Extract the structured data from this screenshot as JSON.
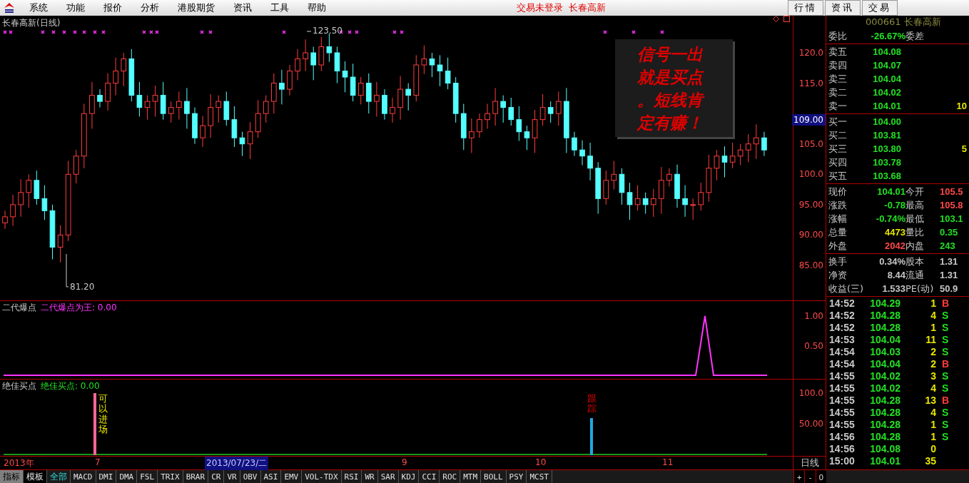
{
  "menu_bar": {
    "items": [
      "系统",
      "功能",
      "报价",
      "分析",
      "港股期货",
      "资讯",
      "工具",
      "帮助"
    ],
    "status": [
      "交易未登录",
      "长春高新"
    ],
    "buttons": [
      "行情",
      "资讯",
      "交易"
    ]
  },
  "chart": {
    "title": "长春高新(日线)",
    "high_label": "123.50",
    "low_label": "81.20",
    "annotation": "信号一出就是买点。短线肯定有赚！",
    "price_axis": [
      "120.0",
      "115.0",
      "105.0",
      "100.0",
      "95.00",
      "90.00",
      "85.00"
    ],
    "cursor_price": "109.00"
  },
  "indicator_1": {
    "name": "二代爆点",
    "value_label": "二代爆点为王: 0.00",
    "axis": [
      "1.00",
      "0.50"
    ]
  },
  "indicator_2": {
    "name": "绝佳买点",
    "value_label": "绝佳买点: 0.00",
    "signals": [
      "可以进场",
      "跟踪"
    ],
    "axis": [
      "100.0",
      "50.00"
    ]
  },
  "date_axis": {
    "labels": [
      "2013年",
      "7",
      "9",
      "10",
      "11"
    ],
    "cursor_date": "2013/07/23/二",
    "period": "日线",
    "zoom_buttons": [
      "+",
      "-",
      "0"
    ]
  },
  "bottom_bar": {
    "modes": [
      {
        "label": "指标",
        "selected": true
      },
      {
        "label": "模板",
        "selected": false
      }
    ],
    "indicators": [
      {
        "label": "全部",
        "selected": true
      },
      {
        "label": "MACD",
        "selected": false
      },
      {
        "label": "DMI",
        "selected": false
      },
      {
        "label": "DMA",
        "selected": false
      },
      {
        "label": "FSL",
        "selected": false
      },
      {
        "label": "TRIX",
        "selected": false
      },
      {
        "label": "BRAR",
        "selected": false
      },
      {
        "label": "CR",
        "selected": false
      },
      {
        "label": "VR",
        "selected": false
      },
      {
        "label": "OBV",
        "selected": false
      },
      {
        "label": "ASI",
        "selected": false
      },
      {
        "label": "EMV",
        "selected": false
      },
      {
        "label": "VOL-TDX",
        "selected": false
      },
      {
        "label": "RSI",
        "selected": false
      },
      {
        "label": "WR",
        "selected": false
      },
      {
        "label": "SAR",
        "selected": false
      },
      {
        "label": "KDJ",
        "selected": false
      },
      {
        "label": "CCI",
        "selected": false
      },
      {
        "label": "ROC",
        "selected": false
      },
      {
        "label": "MTM",
        "selected": false
      },
      {
        "label": "BOLL",
        "selected": false
      },
      {
        "label": "PSY",
        "selected": false
      },
      {
        "label": "MCST",
        "selected": false
      }
    ]
  },
  "quote": {
    "title": "000661 长春高新",
    "ratio": {
      "cells": [
        {
          "label": "委比",
          "value": "-26.67%",
          "color": "#22e022"
        },
        {
          "label": "委差"
        }
      ]
    },
    "asks": [
      {
        "label": "卖五",
        "price": "104.08",
        "color": "#22e022"
      },
      {
        "label": "卖四",
        "price": "104.07",
        "color": "#22e022"
      },
      {
        "label": "卖三",
        "price": "104.04",
        "color": "#22e022"
      },
      {
        "label": "卖二",
        "price": "104.02",
        "color": "#22e022"
      },
      {
        "label": "卖一",
        "price": "104.01",
        "color": "#22e022",
        "volume": "10"
      }
    ],
    "bids": [
      {
        "label": "买一",
        "price": "104.00",
        "color": "#22e022"
      },
      {
        "label": "买二",
        "price": "103.81",
        "color": "#22e022"
      },
      {
        "label": "买三",
        "price": "103.80",
        "color": "#22e022",
        "volume": "5"
      },
      {
        "label": "买四",
        "price": "103.78",
        "color": "#22e022"
      },
      {
        "label": "买五",
        "price": "103.68",
        "color": "#22e022"
      }
    ],
    "stats": [
      {
        "cells": [
          {
            "label": "现价",
            "value": "104.01",
            "color": "#22e022"
          },
          {
            "label": "今开",
            "value": "105.5",
            "color": "#ff4a4a"
          }
        ]
      },
      {
        "cells": [
          {
            "label": "涨跌",
            "value": "-0.78",
            "color": "#22e022"
          },
          {
            "label": "最高",
            "value": "105.8",
            "color": "#ff4a4a"
          }
        ]
      },
      {
        "cells": [
          {
            "label": "涨幅",
            "value": "-0.74%",
            "color": "#22e022"
          },
          {
            "label": "最低",
            "value": "103.1",
            "color": "#22e022"
          }
        ]
      },
      {
        "cells": [
          {
            "label": "总量",
            "value": "4473",
            "color": "#e6e600"
          },
          {
            "label": "量比",
            "value": "0.35",
            "color": "#22e022"
          }
        ]
      },
      {
        "cells": [
          {
            "label": "外盘",
            "value": "2042",
            "color": "#ff4a4a"
          },
          {
            "label": "内盘",
            "value": "243",
            "color": "#22e022"
          }
        ]
      }
    ],
    "finance": [
      {
        "cells": [
          {
            "label": "换手",
            "value": "0.34%",
            "color": "#c8c8c8"
          },
          {
            "label": "股本",
            "value": "1.31",
            "color": "#c8c8c8"
          }
        ]
      },
      {
        "cells": [
          {
            "label": "净资",
            "value": "8.44",
            "color": "#c8c8c8"
          },
          {
            "label": "流通",
            "value": "1.31",
            "color": "#c8c8c8"
          }
        ]
      },
      {
        "cells": [
          {
            "label": "收益(三)",
            "value": "1.533",
            "color": "#c8c8c8"
          },
          {
            "label": "PE(动)",
            "value": "50.9",
            "color": "#c8c8c8"
          }
        ]
      }
    ],
    "ticks": [
      {
        "time": "14:52",
        "price": "104.29",
        "volume": "1",
        "side": "B",
        "kind": "buy"
      },
      {
        "time": "14:52",
        "price": "104.28",
        "volume": "4",
        "side": "S",
        "kind": "sell"
      },
      {
        "time": "14:52",
        "price": "104.28",
        "volume": "1",
        "side": "S",
        "kind": "sell"
      },
      {
        "time": "14:53",
        "price": "104.04",
        "volume": "11",
        "side": "S",
        "kind": "sell"
      },
      {
        "time": "14:54",
        "price": "104.03",
        "volume": "2",
        "side": "S",
        "kind": "sell"
      },
      {
        "time": "14:54",
        "price": "104.04",
        "volume": "2",
        "side": "B",
        "kind": "buy"
      },
      {
        "time": "14:55",
        "price": "104.02",
        "volume": "3",
        "side": "S",
        "kind": "sell"
      },
      {
        "time": "14:55",
        "price": "104.02",
        "volume": "4",
        "side": "S",
        "kind": "sell"
      },
      {
        "time": "14:55",
        "price": "104.28",
        "volume": "13",
        "side": "B",
        "kind": "buy"
      },
      {
        "time": "14:55",
        "price": "104.28",
        "volume": "4",
        "side": "S",
        "kind": "sell"
      },
      {
        "time": "14:55",
        "price": "104.28",
        "volume": "1",
        "side": "S",
        "kind": "sell"
      },
      {
        "time": "14:56",
        "price": "104.28",
        "volume": "1",
        "side": "S",
        "kind": "sell"
      },
      {
        "time": "14:56",
        "price": "104.08",
        "volume": "0",
        "kind": "none"
      },
      {
        "time": "15:00",
        "price": "104.01",
        "volume": "35",
        "kind": "none"
      }
    ]
  }
}
